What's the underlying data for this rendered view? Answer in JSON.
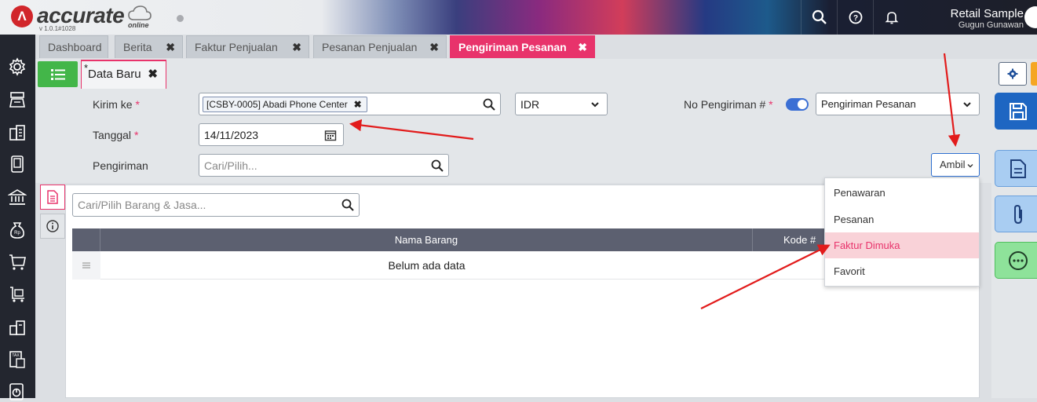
{
  "app": {
    "logo_mark": "Λ",
    "logo_text": "accurate",
    "logo_sub": "online",
    "version": "v 1.0.1#1028",
    "company": "Retail Sample",
    "user": "Gugun Gunawan"
  },
  "tabs": [
    {
      "label": "Dashboard",
      "closable": false
    },
    {
      "label": "Berita",
      "closable": true
    },
    {
      "label": "Faktur Penjualan",
      "closable": true
    },
    {
      "label": "Pesanan Penjualan",
      "closable": true
    },
    {
      "label": "Pengiriman Pesanan",
      "closable": true,
      "active": true
    }
  ],
  "close_glyph": "✖",
  "subtab": {
    "label": "Data Baru",
    "star": "*"
  },
  "form": {
    "kirim_label": "Kirim ke",
    "kirim_value": "[CSBY-0005] Abadi Phone Center",
    "currency": "IDR",
    "tanggal_label": "Tanggal",
    "tanggal_value": "14/11/2023",
    "pengiriman_label": "Pengiriman",
    "pengiriman_placeholder": "Cari/Pilih...",
    "no_label": "No Pengiriman #",
    "no_type": "Pengiriman Pesanan",
    "required_mark": "*"
  },
  "ambil": {
    "label": "Ambil",
    "items": [
      "Penawaran",
      "Pesanan",
      "Faktur Dimuka",
      "Favorit"
    ],
    "highlighted": "Faktur Dimuka"
  },
  "detail": {
    "search_placeholder": "Cari/Pilih Barang & Jasa...",
    "columns": [
      "Nama Barang",
      "Kode #"
    ],
    "empty_text": "Belum ada data"
  },
  "colors": {
    "accent": "#e8336b",
    "menu_green": "#43b649",
    "save_blue": "#1e66c2",
    "sidebar_dark": "#23262f"
  }
}
